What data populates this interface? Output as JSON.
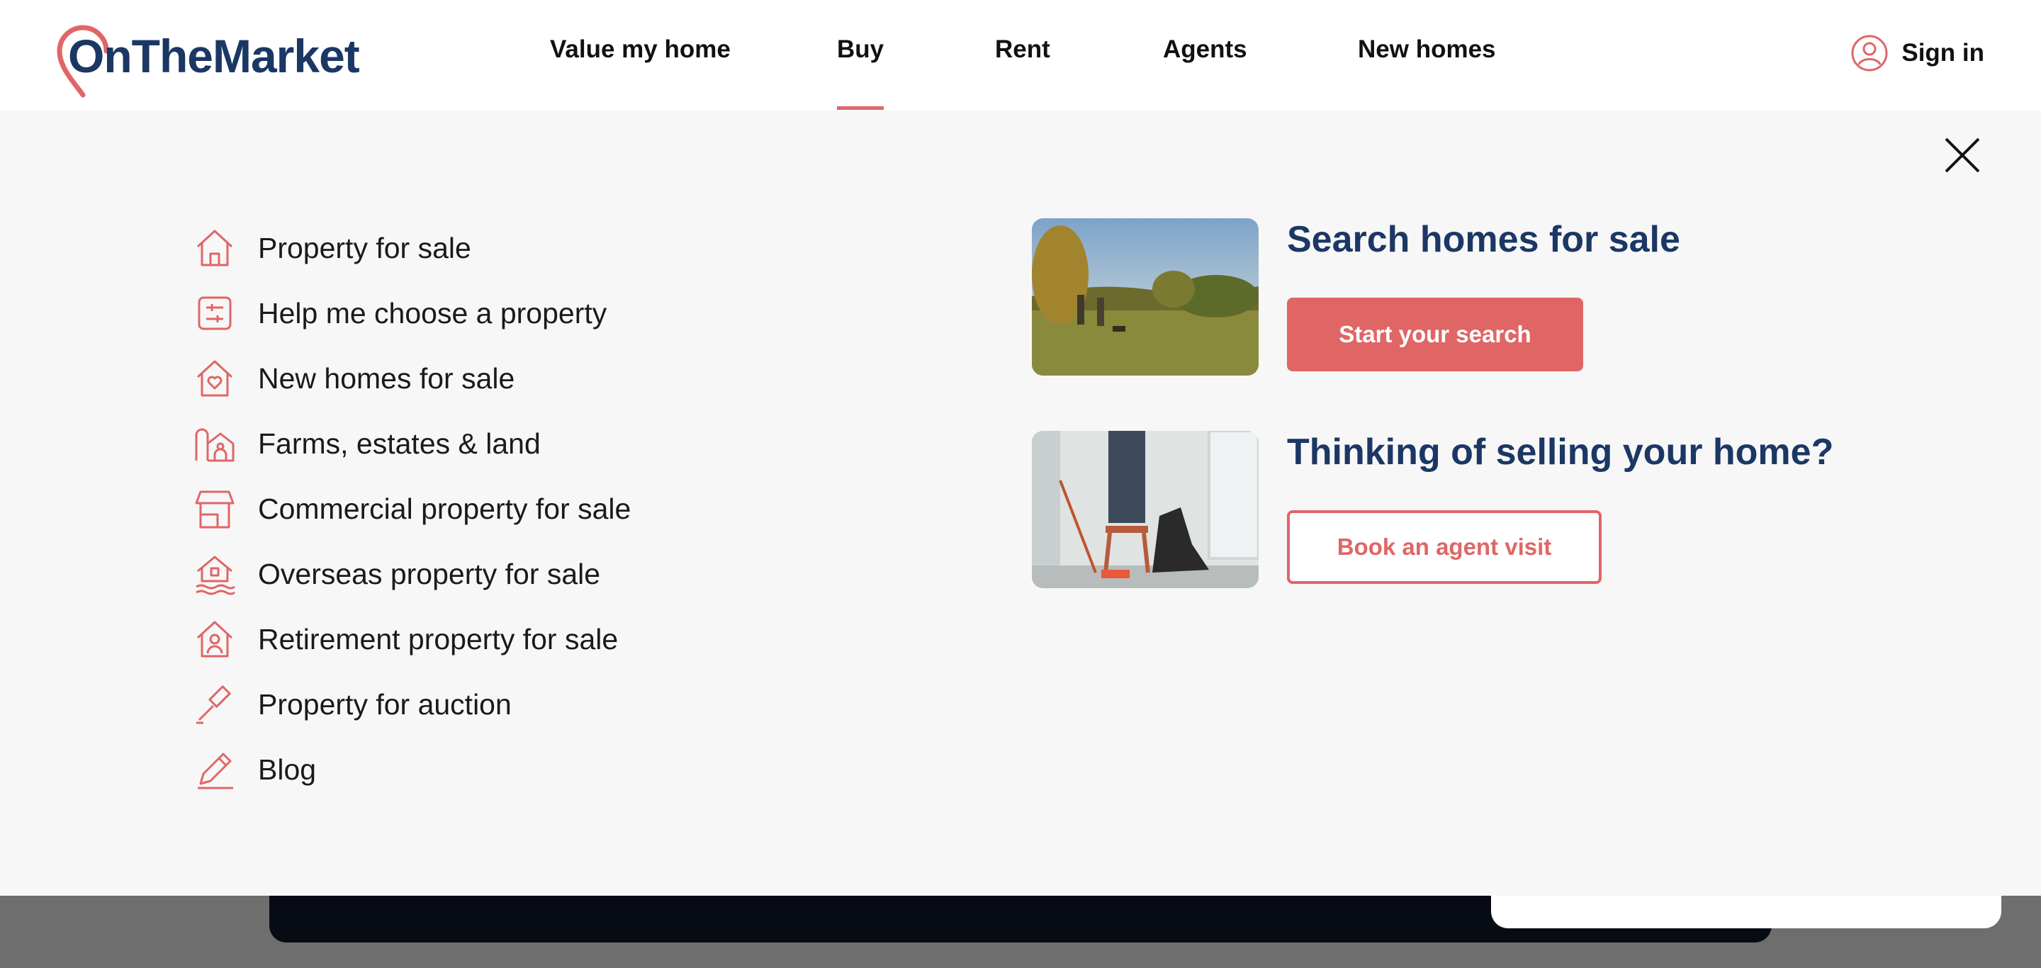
{
  "brand": {
    "name": "OnTheMarket",
    "colors": {
      "accent": "#e06666",
      "navy": "#1b3764"
    }
  },
  "nav": {
    "items": [
      {
        "label": "Value my home"
      },
      {
        "label": "Buy",
        "active": true
      },
      {
        "label": "Rent"
      },
      {
        "label": "Agents"
      },
      {
        "label": "New homes"
      }
    ],
    "sign_in": {
      "label": "Sign in",
      "icon": "user-circle-icon"
    }
  },
  "menu": {
    "close_icon": "close-icon",
    "items": [
      {
        "label": "Property for sale",
        "icon": "house-icon"
      },
      {
        "label": "Help me choose a property",
        "icon": "sliders-icon"
      },
      {
        "label": "New homes for sale",
        "icon": "house-heart-icon"
      },
      {
        "label": "Farms, estates & land",
        "icon": "farm-icon"
      },
      {
        "label": "Commercial property for sale",
        "icon": "shop-icon"
      },
      {
        "label": "Overseas property for sale",
        "icon": "house-waves-icon"
      },
      {
        "label": "Retirement property for sale",
        "icon": "house-person-icon"
      },
      {
        "label": "Property for auction",
        "icon": "gavel-icon"
      },
      {
        "label": "Blog",
        "icon": "pencil-icon"
      }
    ]
  },
  "promos": [
    {
      "title": "Search homes for sale",
      "button": "Start your search",
      "image": "couple-walking-dog-in-park"
    },
    {
      "title": "Thinking of selling your home?",
      "button": "Book an agent visit",
      "image": "couple-painting-room"
    }
  ]
}
